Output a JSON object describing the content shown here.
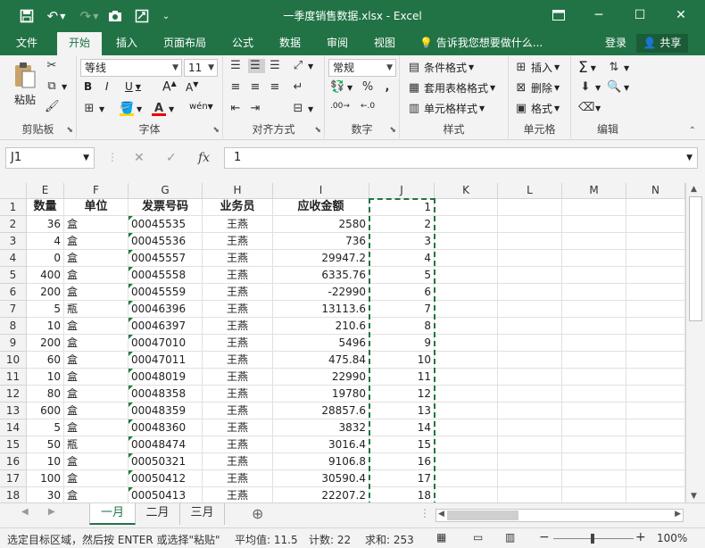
{
  "window": {
    "title": "一季度销售数据.xlsx - Excel"
  },
  "tabs": [
    {
      "label": "文件"
    },
    {
      "label": "开始"
    },
    {
      "label": "插入"
    },
    {
      "label": "页面布局"
    },
    {
      "label": "公式"
    },
    {
      "label": "数据"
    },
    {
      "label": "审阅"
    },
    {
      "label": "视图"
    }
  ],
  "tell_me": "告诉我您想要做什么...",
  "account": {
    "login": "登录",
    "share": "共享"
  },
  "ribbon": {
    "clipboard": {
      "paste": "粘贴",
      "label": "剪贴板"
    },
    "font": {
      "name": "等线",
      "size": "11",
      "label": "字体"
    },
    "alignment": {
      "label": "对齐方式"
    },
    "number": {
      "format": "常规",
      "label": "数字"
    },
    "styles": {
      "conditional": "条件格式",
      "table": "套用表格格式",
      "cell": "单元格样式",
      "label": "样式"
    },
    "cells": {
      "insert": "插入",
      "delete": "删除",
      "format": "格式",
      "label": "单元格"
    },
    "editing": {
      "label": "编辑"
    }
  },
  "formula_bar": {
    "name_box": "J1",
    "value": "1"
  },
  "grid": {
    "columns": [
      "E",
      "F",
      "G",
      "H",
      "I",
      "J",
      "K",
      "L",
      "M",
      "N"
    ],
    "headers": {
      "E": "数量",
      "F": "单位",
      "G": "发票号码",
      "H": "业务员",
      "I": "应收金额",
      "J": "1"
    },
    "rows": [
      {
        "n": "1"
      },
      {
        "n": "2",
        "e": "36",
        "f": "盒",
        "g": "00045535",
        "h": "王燕",
        "i": "2580",
        "j": "2"
      },
      {
        "n": "3",
        "e": "4",
        "f": "盒",
        "g": "00045536",
        "h": "王燕",
        "i": "736",
        "j": "3"
      },
      {
        "n": "4",
        "e": "0",
        "f": "盒",
        "g": "00045557",
        "h": "王燕",
        "i": "29947.2",
        "j": "4"
      },
      {
        "n": "5",
        "e": "400",
        "f": "盒",
        "g": "00045558",
        "h": "王燕",
        "i": "6335.76",
        "j": "5"
      },
      {
        "n": "6",
        "e": "200",
        "f": "盒",
        "g": "00045559",
        "h": "王燕",
        "i": "-22990",
        "j": "6"
      },
      {
        "n": "7",
        "e": "5",
        "f": "瓶",
        "g": "00046396",
        "h": "王燕",
        "i": "13113.6",
        "j": "7"
      },
      {
        "n": "8",
        "e": "10",
        "f": "盒",
        "g": "00046397",
        "h": "王燕",
        "i": "210.6",
        "j": "8"
      },
      {
        "n": "9",
        "e": "200",
        "f": "盒",
        "g": "00047010",
        "h": "王燕",
        "i": "5496",
        "j": "9"
      },
      {
        "n": "10",
        "e": "60",
        "f": "盒",
        "g": "00047011",
        "h": "王燕",
        "i": "475.84",
        "j": "10"
      },
      {
        "n": "11",
        "e": "10",
        "f": "盒",
        "g": "00048019",
        "h": "王燕",
        "i": "22990",
        "j": "11"
      },
      {
        "n": "12",
        "e": "80",
        "f": "盒",
        "g": "00048358",
        "h": "王燕",
        "i": "19780",
        "j": "12"
      },
      {
        "n": "13",
        "e": "600",
        "f": "盒",
        "g": "00048359",
        "h": "王燕",
        "i": "28857.6",
        "j": "13"
      },
      {
        "n": "14",
        "e": "5",
        "f": "盒",
        "g": "00048360",
        "h": "王燕",
        "i": "3832",
        "j": "14"
      },
      {
        "n": "15",
        "e": "50",
        "f": "瓶",
        "g": "00048474",
        "h": "王燕",
        "i": "3016.4",
        "j": "15"
      },
      {
        "n": "16",
        "e": "10",
        "f": "盒",
        "g": "00050321",
        "h": "王燕",
        "i": "9106.8",
        "j": "16"
      },
      {
        "n": "17",
        "e": "100",
        "f": "盒",
        "g": "00050412",
        "h": "王燕",
        "i": "30590.4",
        "j": "17"
      },
      {
        "n": "18",
        "e": "30",
        "f": "盒",
        "g": "00050413",
        "h": "王燕",
        "i": "22207.2",
        "j": "18"
      }
    ]
  },
  "sheets": [
    {
      "label": "一月",
      "active": true
    },
    {
      "label": "二月"
    },
    {
      "label": "三月"
    }
  ],
  "status": {
    "message": "选定目标区域，然后按 ENTER 或选择\"粘贴\"",
    "average": "平均值: 11.5",
    "count": "计数: 22",
    "sum": "求和: 253",
    "zoom": "100%"
  },
  "colors": {
    "accent": "#217346",
    "share_bg": "#1a5c38"
  }
}
